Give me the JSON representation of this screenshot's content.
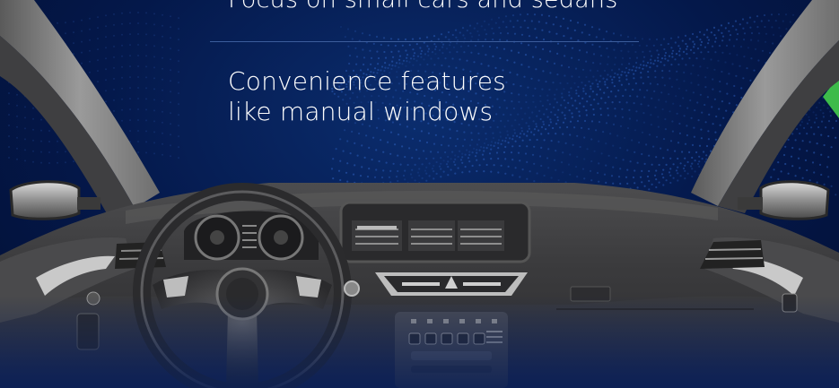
{
  "slide": {
    "partial_heading": "Focus on small cars and sedans",
    "body_line_1": "Convenience features",
    "body_line_2": "like manual windows"
  },
  "colors": {
    "background": "#04184a",
    "text": "#ffffff",
    "divider": "#3c5d9c",
    "accent": "#3dbb4a"
  },
  "illustration": {
    "subject": "car-dashboard-interior",
    "icons": [
      "steering-wheel-icon",
      "instrument-cluster-icon",
      "infotainment-screen-icon",
      "air-vent-icon",
      "side-mirror-icon",
      "hazard-button-icon"
    ]
  }
}
